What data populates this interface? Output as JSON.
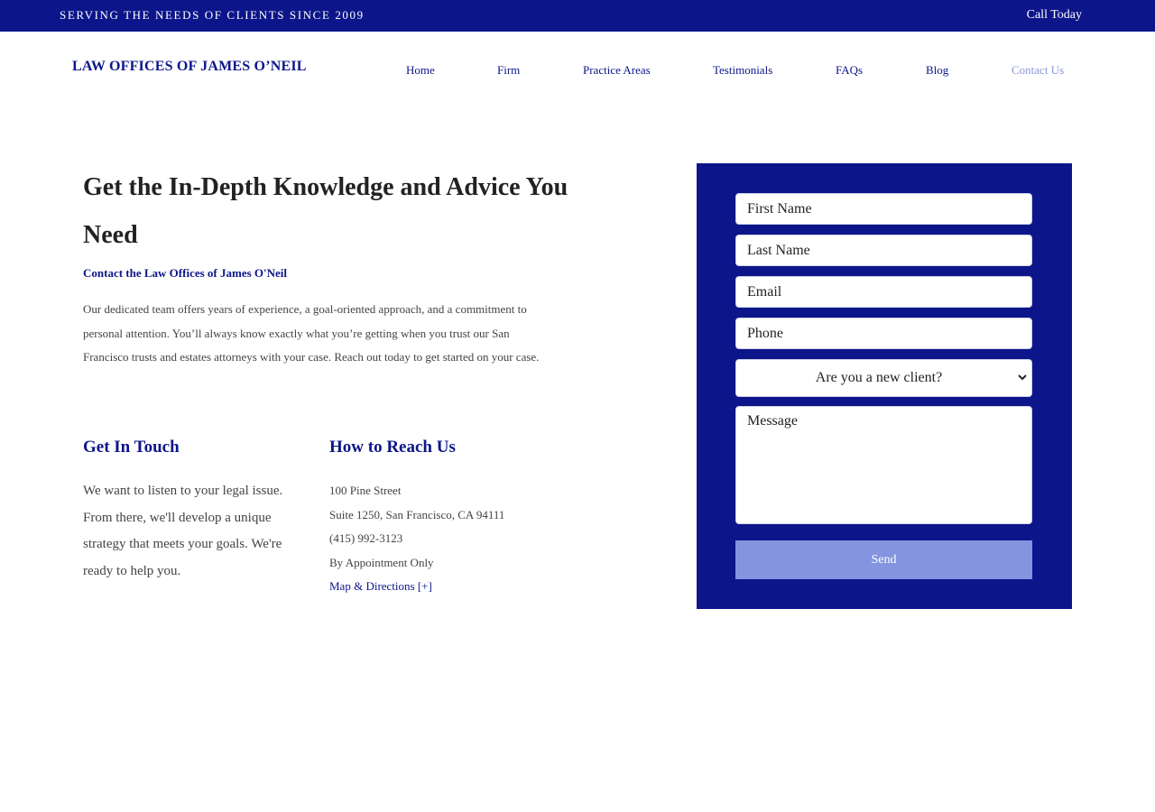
{
  "topbar": {
    "tagline": "SERVING THE NEEDS OF CLIENTS SINCE 2009",
    "call_label": "Call Today"
  },
  "logo": {
    "text": "LAW OFFICES OF JAMES O’NEIL"
  },
  "nav": {
    "items": [
      {
        "label": "Home"
      },
      {
        "label": "Firm"
      },
      {
        "label": "Practice Areas"
      },
      {
        "label": "Testimonials"
      },
      {
        "label": "FAQs"
      },
      {
        "label": "Blog"
      },
      {
        "label": "Contact Us",
        "active": true
      }
    ]
  },
  "hero": {
    "title": "Get the In-Depth Knowledge and Advice You Need",
    "subtitle": "Contact the Law Offices of James O'Neil",
    "body": "Our dedicated team offers years of experience, a goal-oriented approach, and a commitment to personal attention. You’ll always know exactly what you’re getting when you trust our San Francisco trusts and estates attorneys with your case. Reach out today to get started on your case."
  },
  "touch": {
    "title": "Get In Touch",
    "text": "We want to listen to your legal issue. From there, we'll develop a unique strategy that meets your goals. We're ready to help you."
  },
  "reach": {
    "title": "How to Reach Us",
    "address1": "100 Pine Street",
    "address2": "Suite 1250, San Francisco, CA 94111",
    "phone": "(415) 992-3123",
    "appointment": "By Appointment Only",
    "map_link": "Map & Directions [+]"
  },
  "form": {
    "first_name_placeholder": "First Name",
    "last_name_placeholder": "Last Name",
    "email_placeholder": "Email",
    "phone_placeholder": "Phone",
    "new_client_selected": "Are you a new client?",
    "message_placeholder": "Message",
    "send_label": "Send"
  },
  "colors": {
    "brand_navy": "#0c168a",
    "button_blue": "#8494e0",
    "nav_active": "#8a96d8"
  }
}
